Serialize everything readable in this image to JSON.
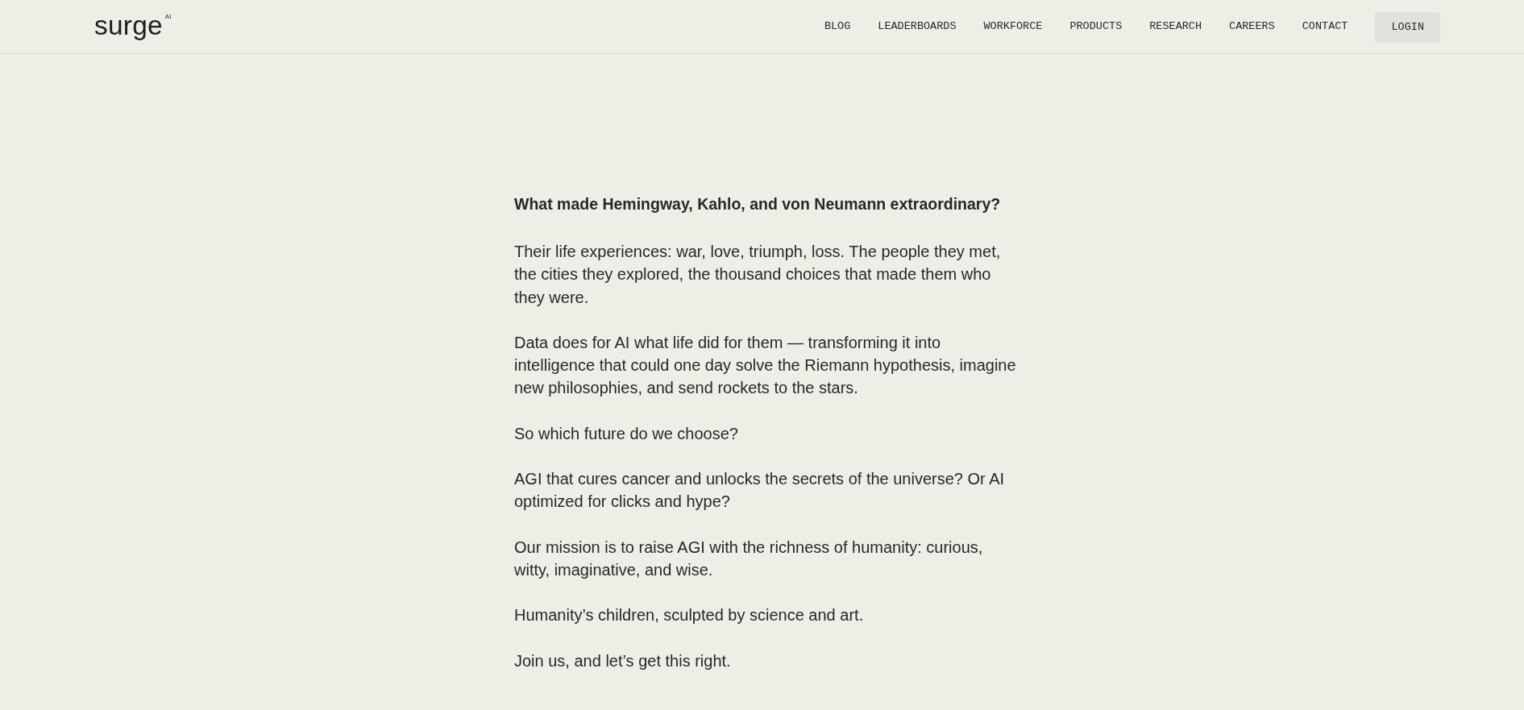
{
  "header": {
    "logo": "surge$^{AI}$",
    "nav": [
      "BLOG",
      "LEADERBOARDS",
      "WORKFORCE",
      "PRODUCTS",
      "RESEARCH",
      "CAREERS",
      "CONTACT"
    ],
    "login_button": "LOGIN"
  },
  "article": {
    "heading": "What made Hemingway, Kahlo, and von Neumann extraordinary?",
    "paragraphs": [
      "Their life experiences: war, love, triumph, loss. The people they met, the cities they explored, the thousand choices that made them who they were.",
      "Data does for AI what life did for them — transforming it into intelligence that could one day solve the Riemann hypothesis, imagine new philosophies, and send rockets to the stars.",
      "So which future do we choose?",
      "AGI that cures cancer and unlocks the secrets of the universe? Or AI optimized for clicks and hype?",
      "Our mission is to raise AGI with the richness of humanity: curious, witty, imaginative, and wise.",
      "Humanity’s children, sculpted by science and art.",
      "Join us, and let’s get this right."
    ]
  }
}
